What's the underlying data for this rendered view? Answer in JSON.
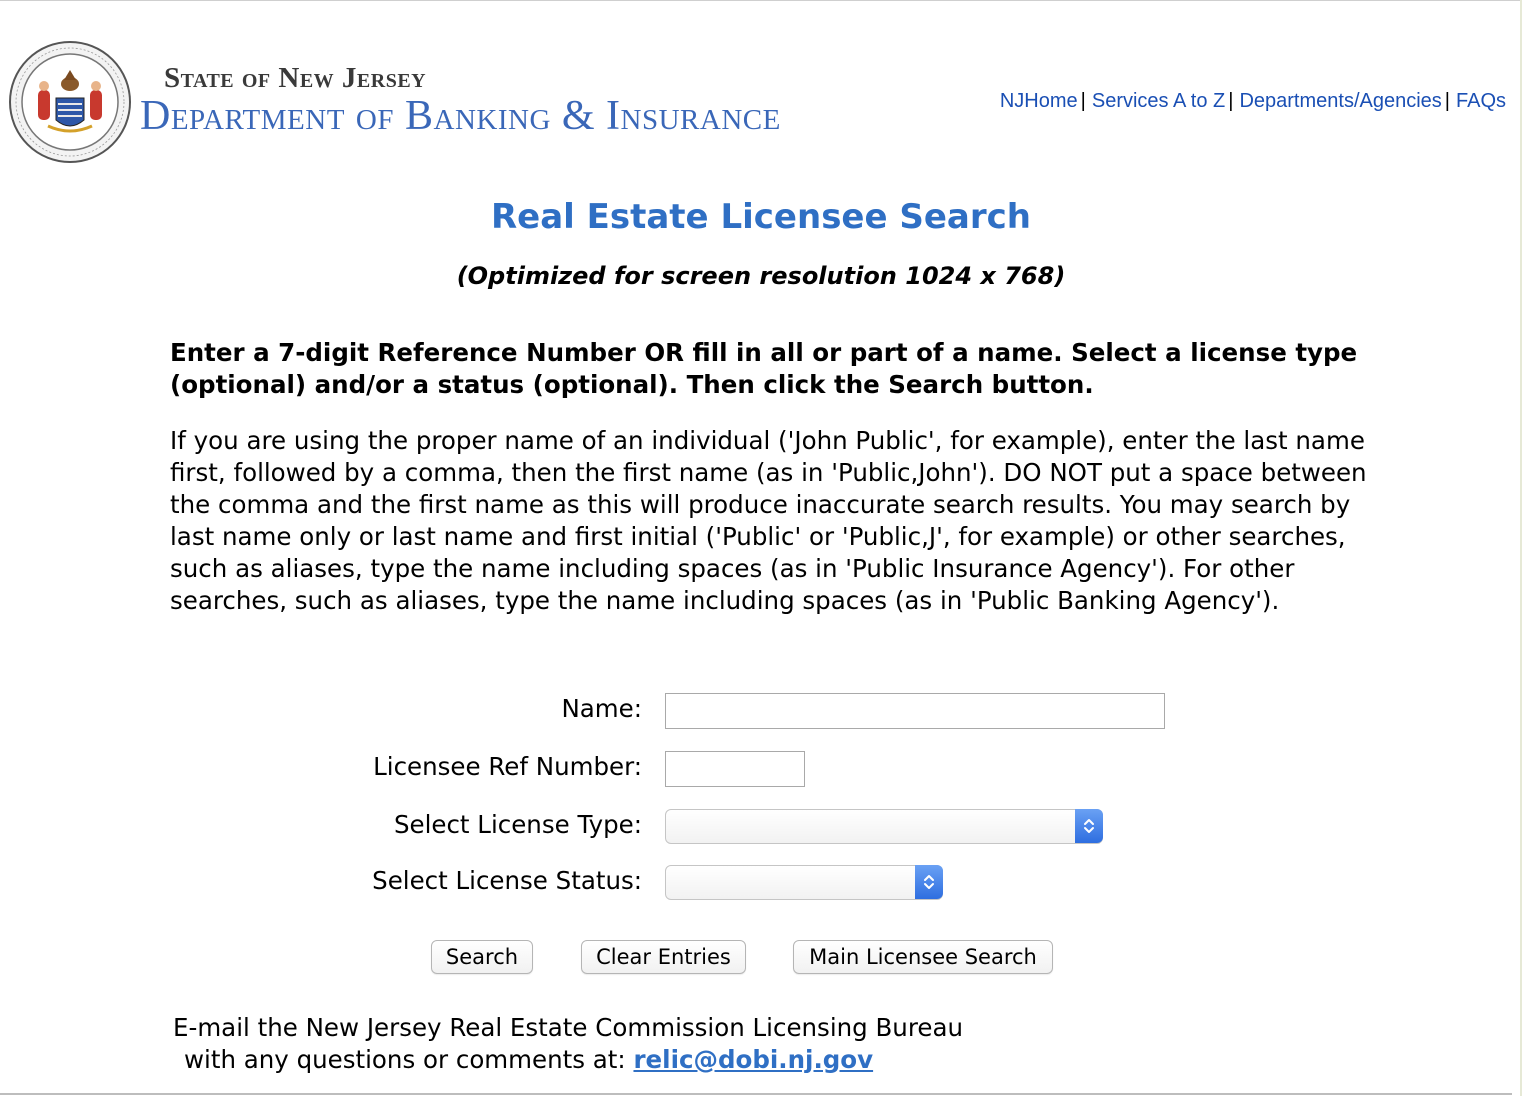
{
  "header": {
    "state_label": "State of New Jersey",
    "department_label": "Department of Banking & Insurance",
    "nav": [
      {
        "label": "NJHome"
      },
      {
        "label": "Services A to Z"
      },
      {
        "label": "Departments/Agencies"
      },
      {
        "label": "FAQs"
      }
    ]
  },
  "page": {
    "title": "Real Estate Licensee Search",
    "subtitle": "(Optimized for screen resolution 1024 x 768)",
    "instructions": "Enter a 7-digit Reference Number OR fill in all or part of a name. Select a license type (optional) and/or a status (optional). Then click the Search button.",
    "paragraph": "If you are using the proper name of an individual ('John Public', for example), enter the last name first, followed by a comma, then the first name (as in 'Public,John'). DO NOT put a space between the comma and the first name as this will produce inaccurate search results. You may search by last name only or last name and first initial ('Public' or 'Public,J', for example) or other searches, such as aliases, type the name including spaces (as in 'Public Insurance Agency'). For other searches, such as aliases, type the name including spaces (as in 'Public Banking Agency')."
  },
  "form": {
    "name_label": "Name:",
    "name_value": "",
    "ref_label": "Licensee Ref Number:",
    "ref_value": "",
    "type_label": "Select License Type:",
    "type_value": "",
    "status_label": "Select License Status:",
    "status_value": ""
  },
  "buttons": {
    "search": "Search",
    "clear": "Clear Entries",
    "main": "Main Licensee Search"
  },
  "footer": {
    "line1": "E-mail the New Jersey Real Estate Commission Licensing Bureau",
    "line2_prefix": "with any questions or comments at:",
    "email": "relic@dobi.nj.gov"
  },
  "colors": {
    "title_blue": "#2f6fc4",
    "link_blue": "#1a4fb4",
    "select_arrow_blue": "#2e6ee0"
  }
}
